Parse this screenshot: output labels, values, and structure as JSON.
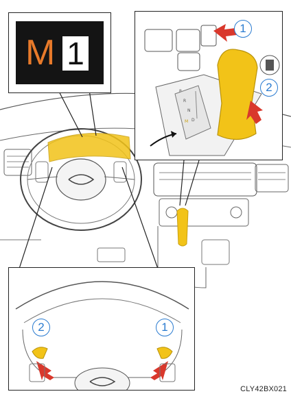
{
  "display": {
    "mode_letter": "M",
    "gear_number": "1"
  },
  "shift_panel": {
    "forward_marker": "1",
    "back_marker": "2",
    "gate_labels": [
      "P",
      "R",
      "N",
      "D",
      "M"
    ]
  },
  "paddle_panel": {
    "left_marker": "2",
    "right_marker": "1"
  },
  "caption": "CLY42BX021",
  "colors": {
    "highlight": "#f2c318",
    "arrow": "#d9382c",
    "marker": "#2a7bd0",
    "display_letter": "#e87a2a"
  }
}
